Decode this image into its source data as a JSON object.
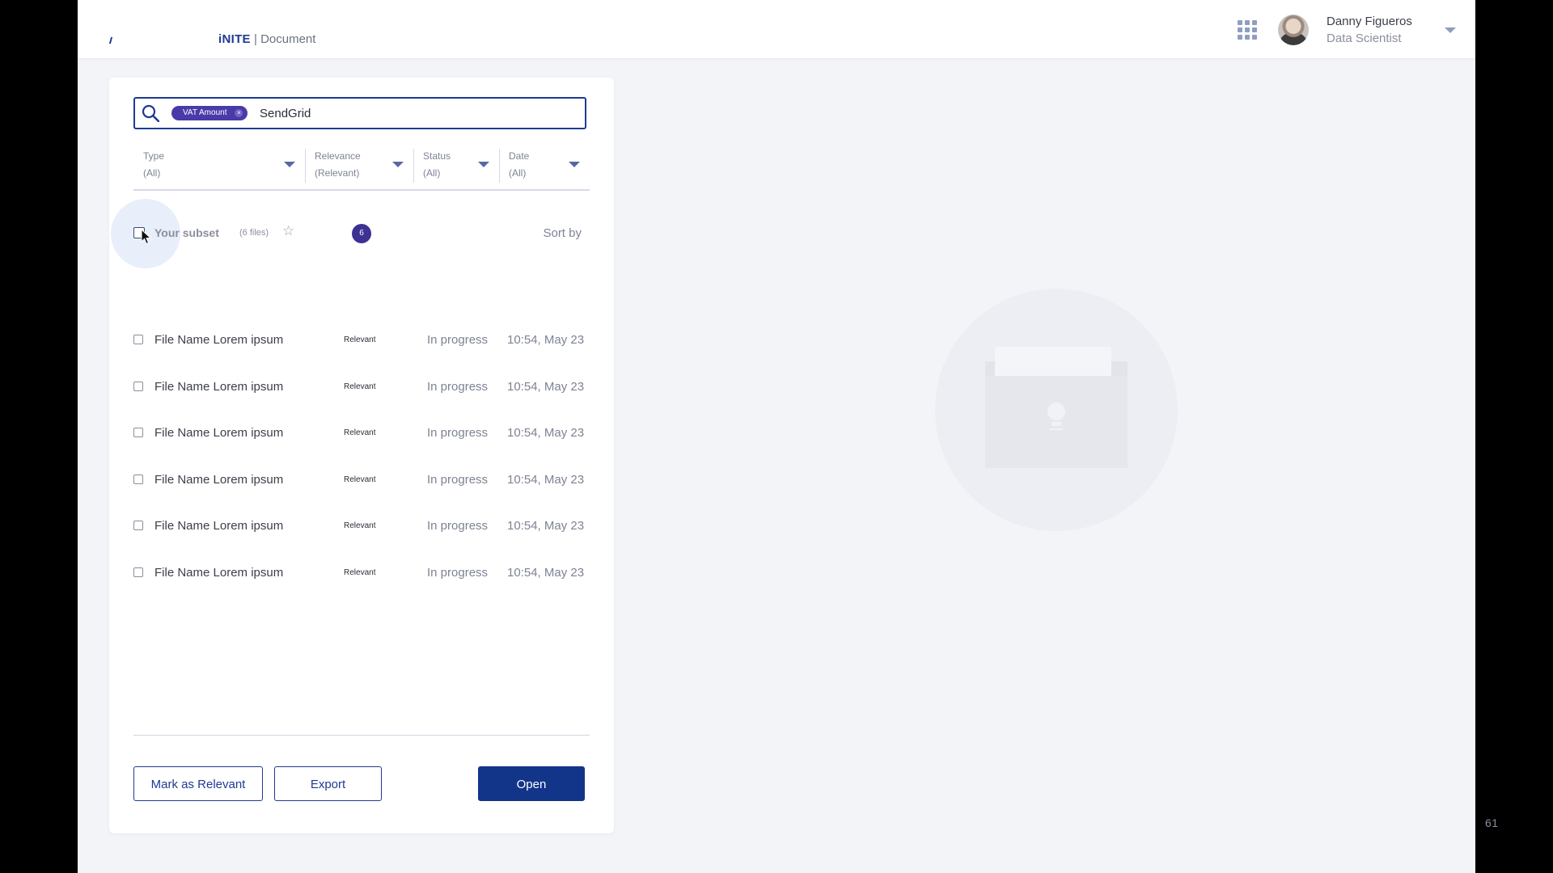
{
  "header": {
    "brand_name": "iNITE",
    "brand_separator": " | ",
    "brand_section": "Document",
    "apps_icon": "grid-icon",
    "user": {
      "name": "Danny Figueros",
      "role": "Data Scientist"
    }
  },
  "search": {
    "icon": "search-icon",
    "chip_label": "VAT Amount",
    "chip_remove": "×",
    "query": "SendGrid"
  },
  "filters": [
    {
      "label": "Type",
      "value": "(All)"
    },
    {
      "label": "Relevance",
      "value": "(Relevant)"
    },
    {
      "label": "Status",
      "value": "(All)"
    },
    {
      "label": "Date",
      "value": "(All)"
    }
  ],
  "subset": {
    "title": "Your subset",
    "count_text": "(6 files)",
    "badge": "6",
    "sort_label": "Sort by"
  },
  "files": [
    {
      "name": "File Name Lorem ipsum",
      "relevance": "Relevant",
      "status": "In progress",
      "time": "10:54, May 23"
    },
    {
      "name": "File Name Lorem ipsum",
      "relevance": "Relevant",
      "status": "In progress",
      "time": "10:54, May 23"
    },
    {
      "name": "File Name Lorem ipsum",
      "relevance": "Relevant",
      "status": "In progress",
      "time": "10:54, May 23"
    },
    {
      "name": "File Name Lorem ipsum",
      "relevance": "Relevant",
      "status": "In progress",
      "time": "10:54, May 23"
    },
    {
      "name": "File Name Lorem ipsum",
      "relevance": "Relevant",
      "status": "In progress",
      "time": "10:54, May 23"
    },
    {
      "name": "File Name Lorem ipsum",
      "relevance": "Relevant",
      "status": "In progress",
      "time": "10:54, May 23"
    }
  ],
  "actions": {
    "mark_relevant": "Mark as Relevant",
    "export": "Export",
    "open": "Open"
  },
  "page_number": "61",
  "colors": {
    "accent": "#1f3a93",
    "chip": "#4a3aa8",
    "badge": "#3d3192",
    "background": "#f3f4f8"
  }
}
